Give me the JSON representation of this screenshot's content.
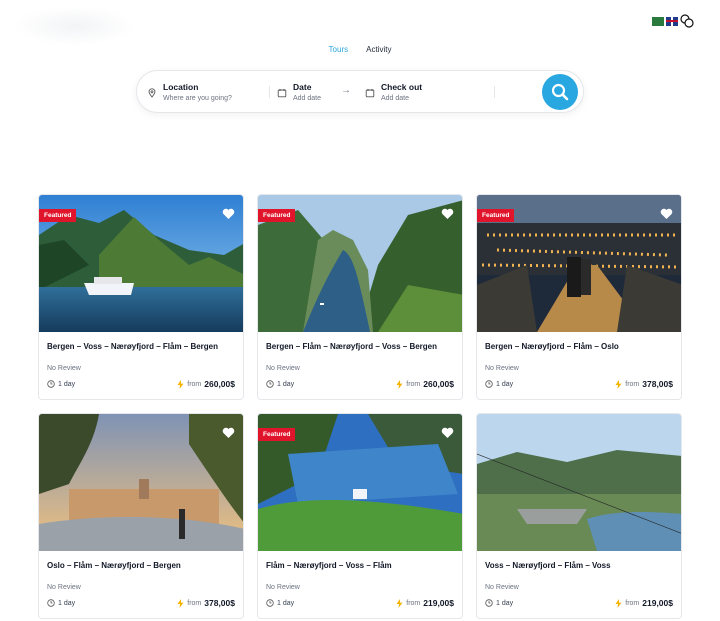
{
  "tabs": [
    "Tours",
    "Activity"
  ],
  "search": {
    "location_label": "Location",
    "location_placeholder": "Where are you going?",
    "date_label": "Date",
    "date_placeholder": "Add date",
    "checkout_label": "Check out",
    "checkout_placeholder": "Add date"
  },
  "tours": [
    {
      "title": "Bergen – Voss – Nærøyfjord – Flåm – Bergen",
      "featured": "Featured",
      "review": "No Review",
      "duration": "1 day",
      "from": "from",
      "price": "260,00$"
    },
    {
      "title": "Bergen – Flåm – Nærøyfjord – Voss – Bergen",
      "featured": "Featured",
      "review": "No Review",
      "duration": "1 day",
      "from": "from",
      "price": "260,00$"
    },
    {
      "title": "Bergen – Nærøyfjord – Flåm – Oslo",
      "featured": "Featured",
      "review": "No Review",
      "duration": "1 day",
      "from": "from",
      "price": "378,00$"
    },
    {
      "title": "Oslo – Flåm – Nærøyfjord – Bergen",
      "featured": "",
      "review": "No Review",
      "duration": "1 day",
      "from": "from",
      "price": "378,00$"
    },
    {
      "title": "Flåm – Nærøyfjord – Voss – Flåm",
      "featured": "Featured",
      "review": "No Review",
      "duration": "1 day",
      "from": "from",
      "price": "219,00$"
    },
    {
      "title": "Voss – Nærøyfjord – Flåm – Voss",
      "featured": "",
      "review": "No Review",
      "duration": "1 day",
      "from": "from",
      "price": "219,00$"
    }
  ],
  "colors": {
    "accent": "#29a7e1",
    "featured": "#e0142b",
    "bolt": "#f5b400"
  }
}
